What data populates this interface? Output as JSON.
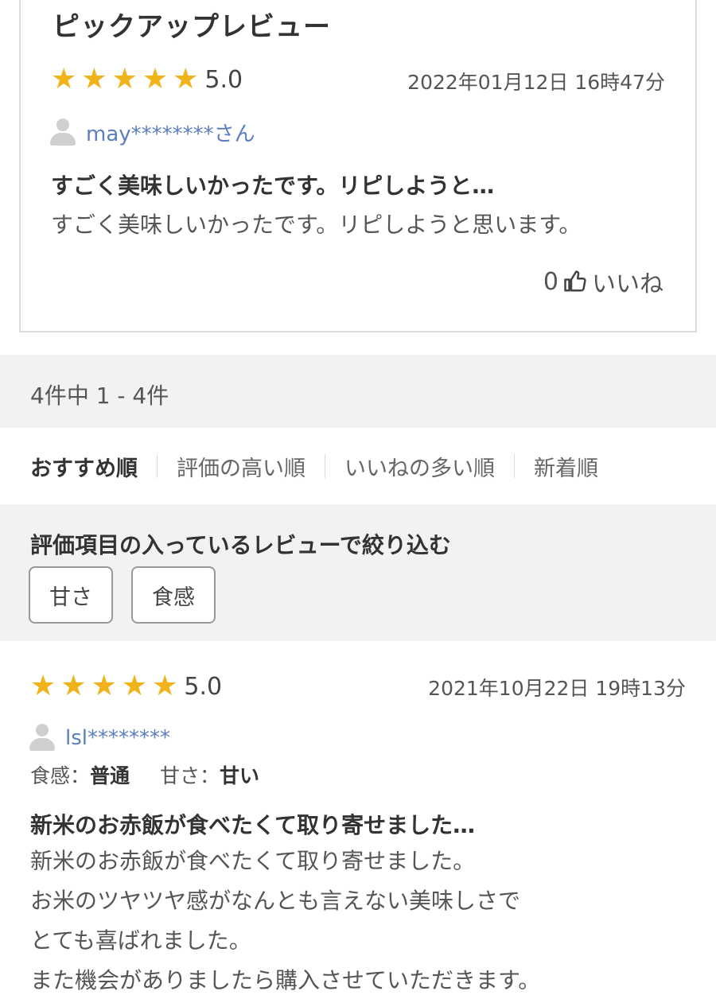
{
  "pickup": {
    "title": "ピックアップレビュー",
    "score": "5.0",
    "rating": 5,
    "date": "2022年01月12日 16時47分",
    "user": "may********さん",
    "headline": "すごく美味しいかったです。リピしようと…",
    "body": "すごく美味しいかったです。リピしようと思います。",
    "like_count": "0",
    "like_label": "いいね"
  },
  "count_text": "4件中 1 - 4件",
  "sort": {
    "items": [
      "おすすめ順",
      "評価の高い順",
      "いいねの多い順",
      "新着順"
    ]
  },
  "filter": {
    "title": "評価項目の入っているレビューで絞り込む",
    "chips": [
      "甘さ",
      "食感"
    ]
  },
  "review1": {
    "score": "5.0",
    "rating": 5,
    "date": "2021年10月22日 19時13分",
    "user": "lsl********",
    "attr1_label": "食感：",
    "attr1_value": "普通",
    "attr2_label": "甘さ：",
    "attr2_value": "甘い",
    "headline": "新米のお赤飯が食べたくて取り寄せました…",
    "body_lines": [
      "新米のお赤飯が食べたくて取り寄せました。",
      "お米のツヤツヤ感がなんとも言えない美味しさで",
      "とても喜ばれました。",
      "また機会がありましたら購入させていただきます。"
    ]
  },
  "colors": {
    "star": "#f0b31a",
    "user_link": "#5b7fc0",
    "section_bg": "#f2f2f2"
  },
  "icons": {
    "star": "star-icon",
    "avatar": "user-avatar-icon",
    "like": "thumbs-up-icon"
  }
}
